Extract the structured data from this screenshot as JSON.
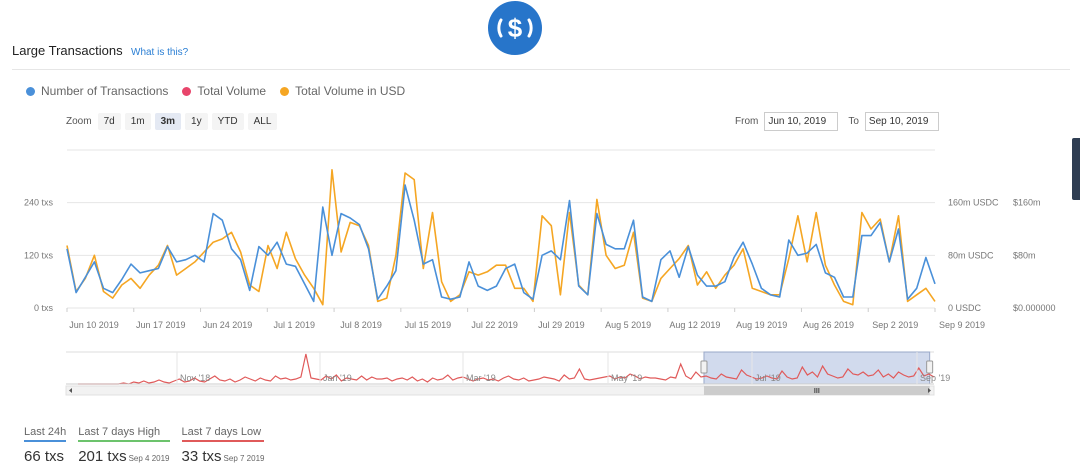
{
  "header": {
    "title": "Large Transactions",
    "help_link": "What is this?"
  },
  "colors": {
    "transactions": "#4a90d9",
    "volume": "#e8456b",
    "volume_usd": "#f5a623",
    "navigator": "#e05a5a",
    "brand": "#2775ca"
  },
  "legend": {
    "items": [
      {
        "label": "Number of Transactions"
      },
      {
        "label": "Total Volume"
      },
      {
        "label": "Total Volume in USD"
      }
    ]
  },
  "zoom": {
    "label": "Zoom",
    "options": [
      "7d",
      "1m",
      "3m",
      "1y",
      "YTD",
      "ALL"
    ],
    "active": "3m"
  },
  "range": {
    "from_label": "From",
    "from_value": "Jun 10, 2019",
    "to_label": "To",
    "to_value": "Sep 10, 2019"
  },
  "chart_data": {
    "type": "line",
    "x_ticks": [
      "Jun 10 2019",
      "Jun 17 2019",
      "Jun 24 2019",
      "Jul 1 2019",
      "Jul 8 2019",
      "Jul 15 2019",
      "Jul 22 2019",
      "Jul 29 2019",
      "Aug 5 2019",
      "Aug 12 2019",
      "Aug 19 2019",
      "Aug 26 2019",
      "Sep 2 2019",
      "Sep 9 2019"
    ],
    "y_left_ticks": [
      "0 txs",
      "120 txs",
      "240 txs"
    ],
    "y_right1_ticks": [
      "0 USDC",
      "80m USDC",
      "160m USDC"
    ],
    "y_right2_ticks": [
      "$0.000000",
      "$80m",
      "$160m"
    ],
    "ylim_left": [
      0,
      360
    ],
    "ylim_right": [
      0,
      240
    ],
    "series": [
      {
        "name": "Number of Transactions",
        "axis": "left",
        "values": [
          135,
          35,
          70,
          105,
          45,
          35,
          65,
          100,
          80,
          85,
          90,
          140,
          105,
          110,
          120,
          105,
          215,
          200,
          135,
          110,
          40,
          140,
          120,
          150,
          100,
          95,
          55,
          15,
          230,
          120,
          215,
          205,
          190,
          135,
          20,
          50,
          85,
          280,
          200,
          100,
          110,
          25,
          20,
          25,
          105,
          50,
          40,
          50,
          90,
          100,
          35,
          20,
          120,
          130,
          110,
          245,
          50,
          30,
          215,
          145,
          135,
          135,
          200,
          25,
          15,
          110,
          130,
          70,
          140,
          75,
          50,
          50,
          60,
          115,
          150,
          100,
          45,
          30,
          25,
          155,
          120,
          125,
          145,
          80,
          70,
          25,
          25,
          165,
          165,
          195,
          105,
          180,
          20,
          45,
          115,
          55
        ]
      },
      {
        "name": "Total Volume in USD",
        "axis": "right",
        "values": [
          95,
          25,
          45,
          80,
          25,
          15,
          35,
          45,
          30,
          50,
          65,
          95,
          50,
          60,
          70,
          85,
          100,
          105,
          115,
          85,
          35,
          25,
          95,
          60,
          115,
          75,
          50,
          30,
          5,
          210,
          85,
          130,
          125,
          95,
          10,
          15,
          80,
          205,
          195,
          60,
          145,
          40,
          10,
          20,
          55,
          50,
          55,
          65,
          65,
          30,
          30,
          10,
          140,
          125,
          20,
          145,
          35,
          20,
          165,
          80,
          60,
          65,
          115,
          15,
          10,
          45,
          60,
          75,
          95,
          35,
          55,
          30,
          50,
          65,
          90,
          30,
          25,
          20,
          20,
          75,
          140,
          70,
          145,
          65,
          35,
          10,
          5,
          145,
          120,
          135,
          70,
          140,
          10,
          20,
          30,
          10
        ]
      }
    ],
    "navigator": {
      "x_ticks": [
        "Nov '18",
        "Jan '19",
        "Mar '19",
        "May '19",
        "Jul '19",
        "Sep '19"
      ],
      "values": [
        0,
        0,
        0,
        0,
        0,
        0,
        0,
        0,
        0,
        1,
        0,
        2,
        1,
        3,
        1,
        2,
        4,
        2,
        1,
        3,
        5,
        2,
        3,
        6,
        3,
        2,
        5,
        8,
        4,
        3,
        5,
        2,
        4,
        7,
        5,
        3,
        6,
        4,
        3,
        8,
        5,
        6,
        4,
        5,
        7,
        30,
        6,
        5,
        4,
        8,
        5,
        9,
        3,
        6,
        5,
        4,
        8,
        4,
        7,
        5,
        5,
        6,
        3,
        5,
        6,
        4,
        7,
        3,
        5,
        2,
        6,
        4,
        5,
        9,
        4,
        6,
        7,
        5,
        3,
        5,
        6,
        4,
        5,
        3,
        6,
        8,
        5,
        4,
        6,
        3,
        4,
        5,
        7,
        6,
        5,
        3,
        9,
        5,
        6,
        15,
        5,
        4,
        5,
        6,
        7,
        8,
        5,
        7,
        6,
        10,
        8,
        5,
        7,
        6,
        6,
        5,
        4,
        7,
        6,
        20,
        8,
        5,
        12,
        7,
        8,
        6,
        5,
        10,
        7,
        6,
        5,
        14,
        9,
        7,
        5,
        6,
        8,
        6,
        5,
        13,
        7,
        5,
        6,
        17,
        9,
        12,
        7,
        18,
        10,
        8,
        6,
        7,
        15,
        10,
        9,
        12,
        8,
        9,
        14,
        7,
        10,
        6,
        12,
        9,
        7,
        8,
        16,
        8,
        10,
        7
      ],
      "selection": [
        0.735,
        0.995
      ]
    }
  },
  "stats": [
    {
      "label": "Last 24h",
      "value": "66 txs",
      "date": "",
      "color": "#4a90d9"
    },
    {
      "label": "Last 7 days High",
      "value": "201 txs",
      "date": "Sep 4 2019",
      "color": "#6cc36c"
    },
    {
      "label": "Last 7 days Low",
      "value": "33 txs",
      "date": "Sep 7 2019",
      "color": "#e05a5a"
    }
  ]
}
